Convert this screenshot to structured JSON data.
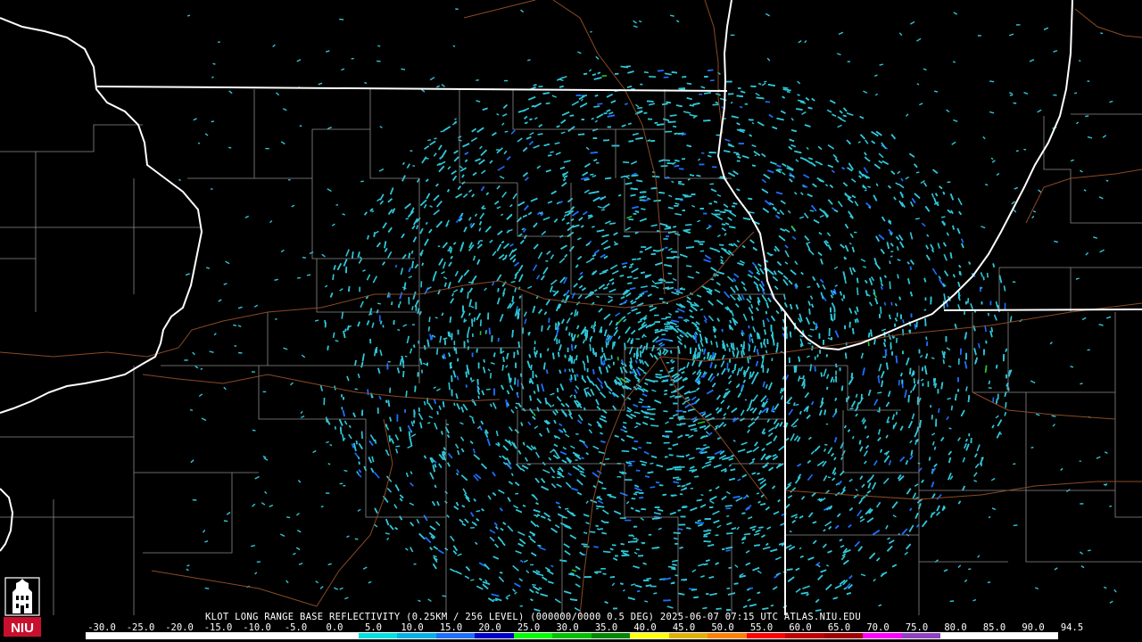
{
  "product_caption": "KLOT LONG RANGE BASE REFLECTIVITY (0.25KM / 256 LEVEL) (000000/0000 0.5 DEG) 2025-06-07 07:15 UTC  ATLAS.NIU.EDU",
  "legend": {
    "ticks": [
      "-30.0",
      "-25.0",
      "-20.0",
      "-15.0",
      "-10.0",
      "-5.0",
      "0.0",
      "5.0",
      "10.0",
      "15.0",
      "20.0",
      "25.0",
      "30.0",
      "35.0",
      "40.0",
      "45.0",
      "50.0",
      "55.0",
      "60.0",
      "65.0",
      "70.0",
      "75.0",
      "80.0",
      "85.0",
      "90.0",
      "94.5"
    ],
    "colors": [
      "#ffffff",
      "#ffffff",
      "#ffffff",
      "#ffffff",
      "#ffffff",
      "#ffffff",
      "#ffffff",
      "#00e0e0",
      "#00b0e8",
      "#1e6eff",
      "#0000c8",
      "#00ff00",
      "#00c000",
      "#008800",
      "#ffff00",
      "#e0b000",
      "#ff8000",
      "#ff0000",
      "#c00000",
      "#a00000",
      "#ff00ff",
      "#9040c0",
      "#ffffff",
      "#ffffff",
      "#ffffff"
    ]
  },
  "logo": {
    "text": "NIU",
    "icon": "niu-altgeld-tower-logo",
    "color": "#c8102e"
  },
  "map": {
    "colors": {
      "state_border": "#ffffff",
      "county_line": "#8a8a8a",
      "highway": "#8b4a24",
      "echo_light": "#2fc7d8",
      "echo_mid": "#1e6eff",
      "echo_green": "#2ebd2e"
    },
    "radar": "KLOT"
  }
}
